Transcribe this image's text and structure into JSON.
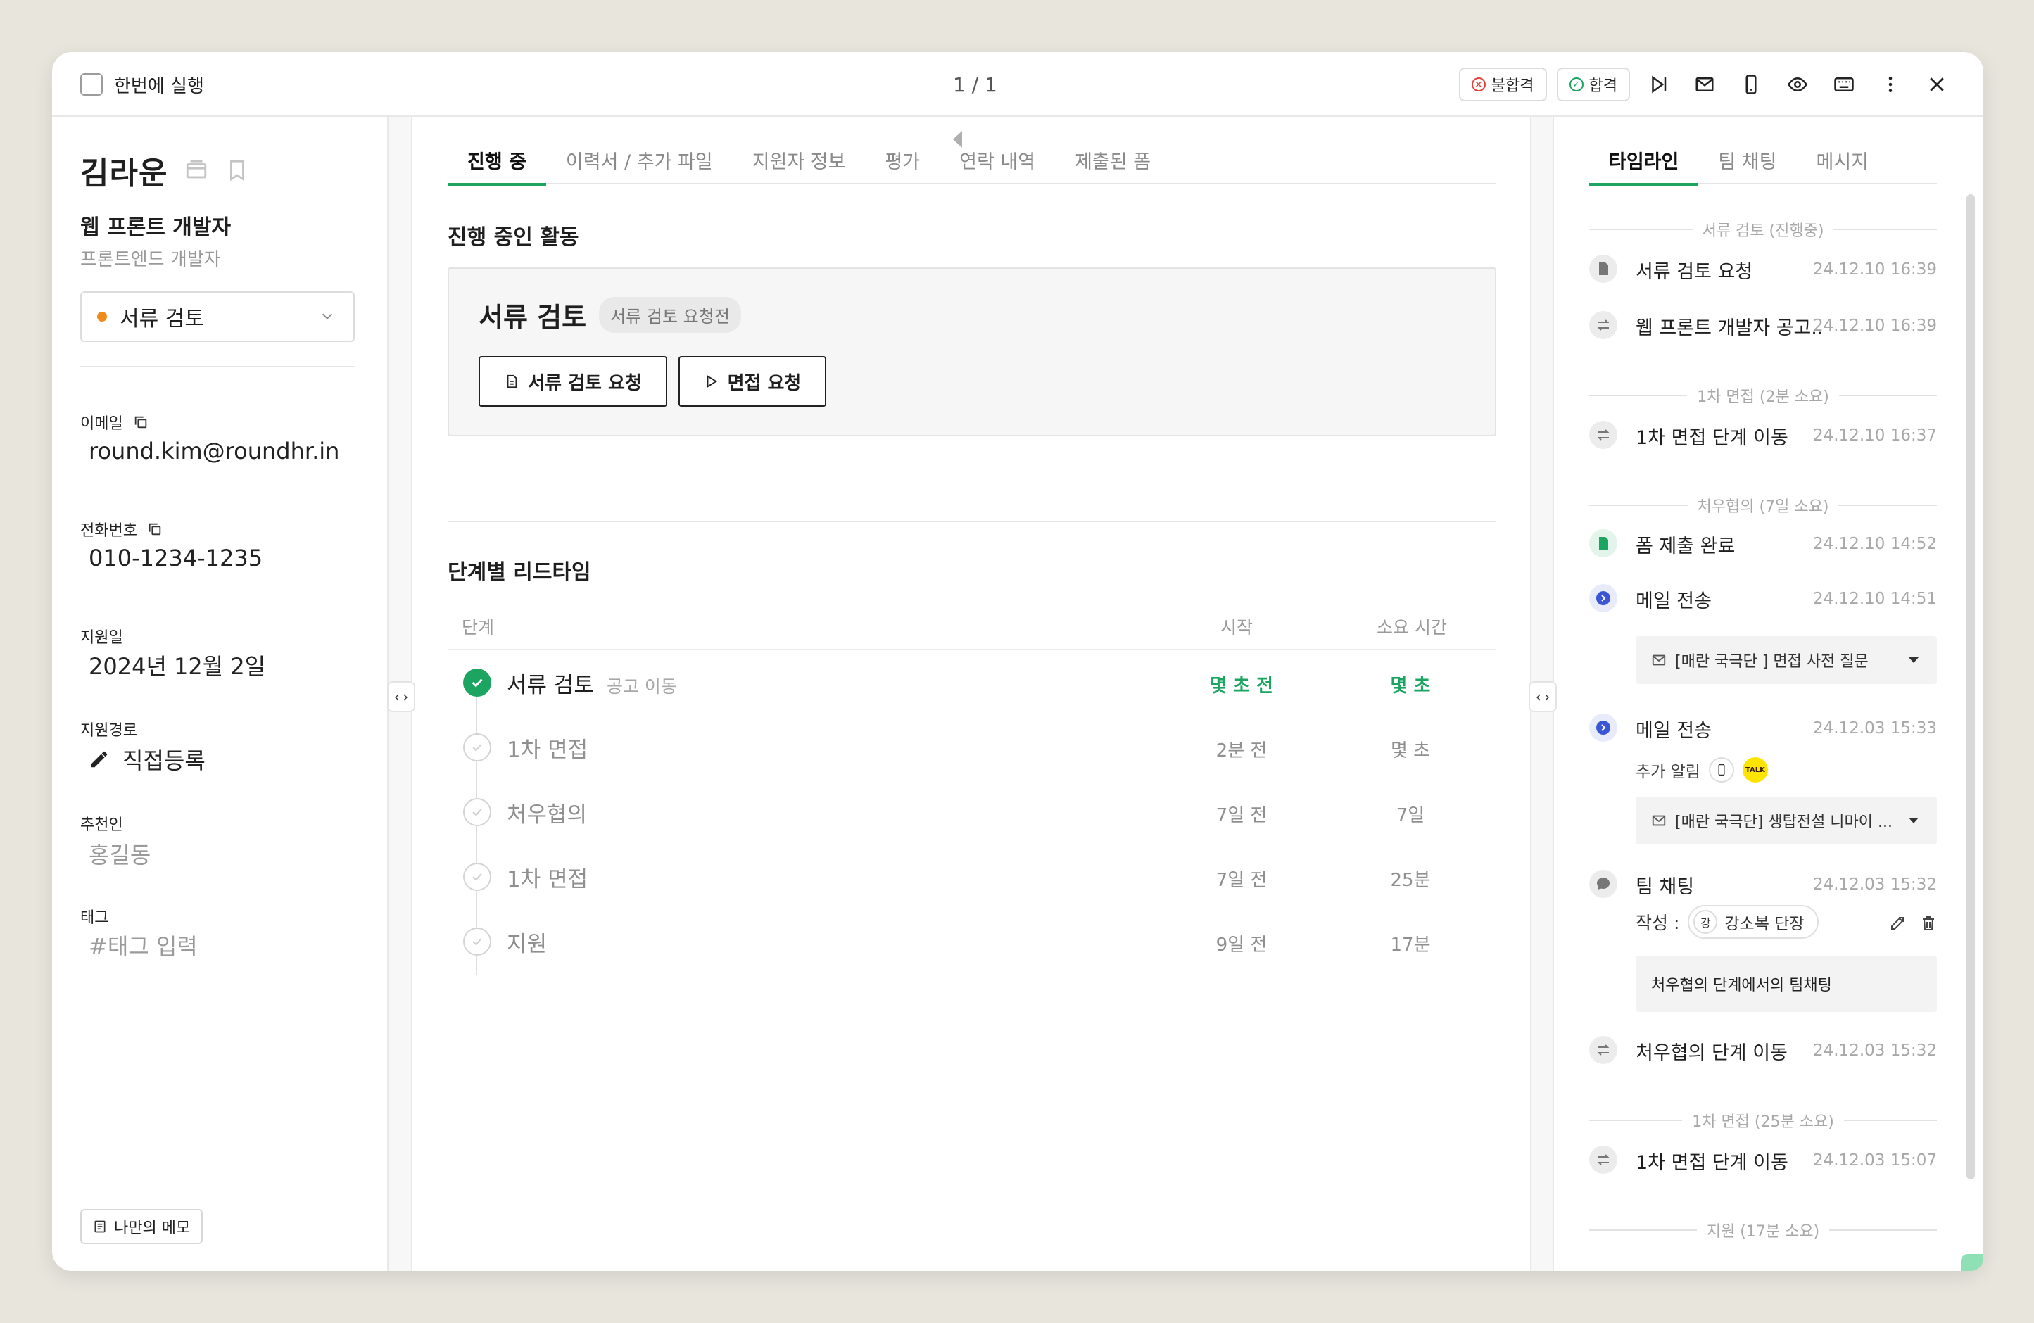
{
  "topbar": {
    "run_once_label": "한번에 실행",
    "pager_text": "1 / 1",
    "fail_label": "불합격",
    "pass_label": "합격"
  },
  "candidate": {
    "name": "김라운",
    "job_title": "웹 프론트 개발자",
    "job_subtitle": "프론트엔드 개발자",
    "stage": "서류 검토",
    "stage_dot_color": "#f08a1a",
    "email_label": "이메일",
    "email": "round.kim@roundhr.in",
    "phone_label": "전화번호",
    "phone": "010-1234-1235",
    "applied_label": "지원일",
    "applied_date": "2024년 12월 2일",
    "source_label": "지원경로",
    "source": "직접등록",
    "referrer_label": "추천인",
    "referrer": "홍길동",
    "tag_label": "태그",
    "tag_placeholder": "#태그 입력",
    "memo_button": "나만의 메모"
  },
  "center": {
    "tabs": [
      "진행 중",
      "이력서 / 추가 파일",
      "지원자 정보",
      "평가",
      "연락 내역",
      "제출된 폼"
    ],
    "activity_title": "진행 중인 활동",
    "activity_stage": "서류 검토",
    "activity_tag": "서류 검토 요청전",
    "doc_request_button": "서류 검토 요청",
    "interview_request_button": "면접 요청",
    "leadtime_title": "단계별 리드타임",
    "col_stage": "단계",
    "col_start": "시작",
    "col_duration": "소요 시간",
    "rows": [
      {
        "stage": "서류 검토",
        "hint": "공고 이동",
        "start": "몇 초 전",
        "duration": "몇 초",
        "done": true
      },
      {
        "stage": "1차 면접",
        "hint": "",
        "start": "2분 전",
        "duration": "몇 초",
        "done": false
      },
      {
        "stage": "처우협의",
        "hint": "",
        "start": "7일 전",
        "duration": "7일",
        "done": false
      },
      {
        "stage": "1차 면접",
        "hint": "",
        "start": "7일 전",
        "duration": "25분",
        "done": false
      },
      {
        "stage": "지원",
        "hint": "",
        "start": "9일 전",
        "duration": "17분",
        "done": false
      }
    ]
  },
  "timeline": {
    "tabs": [
      "타임라인",
      "팀 채팅",
      "메시지"
    ],
    "sep1": "서류 검토 (진행중)",
    "ev1_title": "서류 검토 요청",
    "ev1_time": "24.12.10 16:39",
    "ev2_title": "웹 프론트 개발자 공고...",
    "ev2_time": "24.12.10 16:39",
    "sep2": "1차 면접 (2분 소요)",
    "ev3_title": "1차 면접 단계 이동",
    "ev3_time": "24.12.10 16:37",
    "sep3": "처우협의 (7일 소요)",
    "ev4_title": "폼 제출 완료",
    "ev4_time": "24.12.10 14:52",
    "ev5_title": "메일 전송",
    "ev5_time": "24.12.10 14:51",
    "mail1": "[매란 국극단 ] 면접 사전 질문",
    "ev6_title": "메일 전송",
    "ev6_time": "24.12.03 15:33",
    "addon_label": "추가 알림",
    "kakao_label": "TALK",
    "mail2": "[매란 국극단] 생탑전설 니마이 ...",
    "ev7_title": "팀 채팅",
    "ev7_time": "24.12.03 15:32",
    "author_label": "작성 :",
    "author_initial": "강",
    "author_name": "강소복 단장",
    "chat_text": "처우협의 단계에서의 팀채팅",
    "ev8_title": "처우협의 단계 이동",
    "ev8_time": "24.12.03 15:32",
    "sep4": "1차 면접 (25분 소요)",
    "ev9_title": "1차 면접 단계 이동",
    "ev9_time": "24.12.03 15:07",
    "sep5": "지원 (17분 소요)"
  },
  "colors": {
    "accent_green": "#1ba561",
    "fail_red": "#e0463c",
    "event_blue": "#3a56d4"
  }
}
